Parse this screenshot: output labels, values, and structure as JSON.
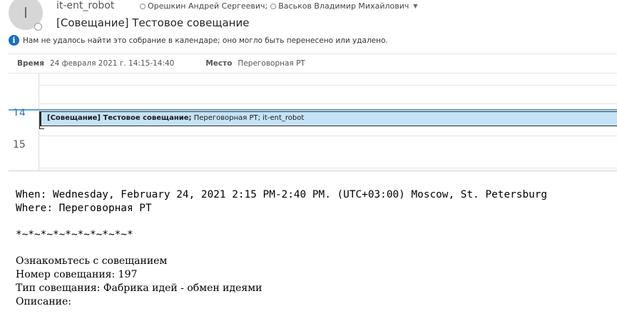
{
  "header": {
    "avatar_initial": "I",
    "sender": "it-ent_robot",
    "recipients": [
      "Орешкин Андрей Сергеевич;",
      "Васьков Владимир Михайлович"
    ],
    "subject": "[Совещание] Тестовое совещание",
    "info_message": "Нам не удалось найти это собрание в календаре; оно могло быть перенесено или удалено."
  },
  "meeting": {
    "time_label": "Время",
    "time_value": "24 февраля 2021 г. 14:15-14:40",
    "location_label": "Место",
    "location_value": "Переговорная PT"
  },
  "calendar": {
    "hours": [
      "14",
      "15"
    ],
    "event": {
      "title_bold": "[Совещание] Тестовое совещание;",
      "details": " Переговорная PT; it-ent_robot"
    },
    "colors": {
      "event_fill": "#c5e3f6",
      "now_line": "#5ea1d8"
    }
  },
  "body": {
    "when": "When: Wednesday, February 24, 2021 2:15 PM-2:40 PM. (UTC+03:00) Moscow, St. Petersburg",
    "where": "Where: Переговорная PT",
    "separator": "*~*~*~*~*~*~*~*~*~*",
    "lines": [
      "Ознакомьтесь с совещанием",
      "Номер совещания: 197",
      "Тип совещания: Фабрика идей - обмен идеями",
      "Описание:"
    ]
  },
  "icons": {
    "info": "info-icon",
    "presence": "presence-status-icon",
    "expand": "chevron-down-icon"
  },
  "colors": {
    "info_icon": "#1a6fc2",
    "hour_now": "#2a72b5"
  }
}
